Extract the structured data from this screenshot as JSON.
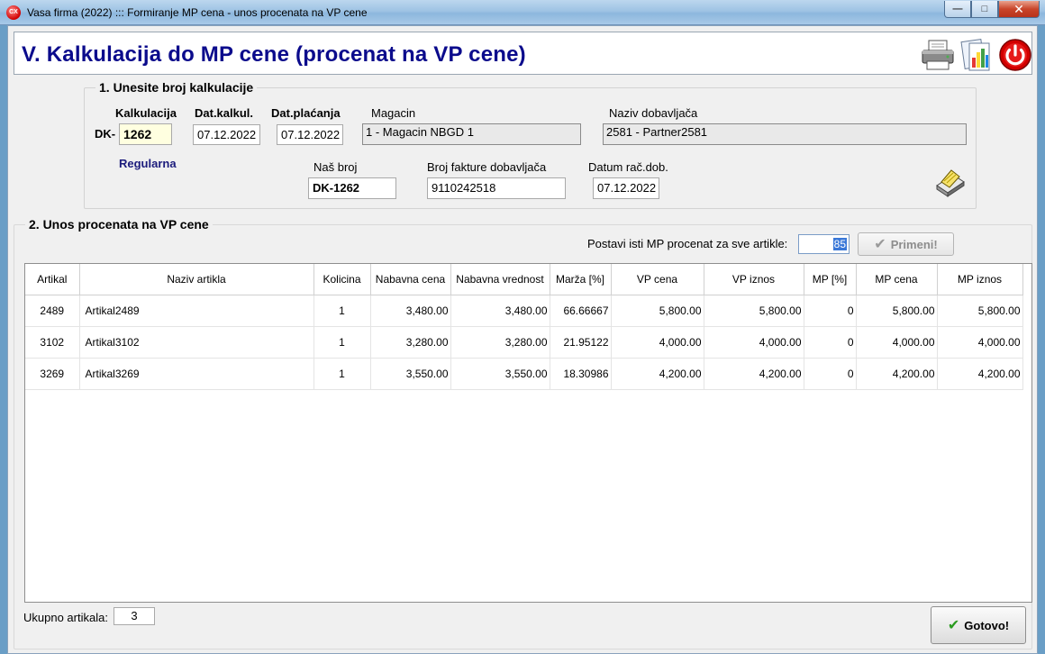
{
  "window": {
    "title": "Vasa firma (2022) ::: Formiranje MP cena - unos procenata na VP cene",
    "app_icon_text": "CX",
    "minimize_symbol": "—",
    "maximize_symbol": "□",
    "close_symbol": "✕"
  },
  "header": {
    "title": "V. Kalkulacija do MP cene (procenat na VP cene)"
  },
  "section1": {
    "title": "1. Unesite broj kalkulacije",
    "kalkulacija_label": "Kalkulacija",
    "prefix": "DK-",
    "kalkulacija_value": "1262",
    "type": "Regularna",
    "dat_kalkul_label": "Dat.kalkul.",
    "dat_kalkul_value": "07.12.2022",
    "dat_placanja_label": "Dat.plaćanja",
    "dat_placanja_value": "07.12.2022",
    "magacin_label": "Magacin",
    "magacin_value": "1 - Magacin NBGD 1",
    "dobavljac_label": "Naziv dobavljača",
    "dobavljac_value": "2581 - Partner2581",
    "nas_broj_label": "Naš broj",
    "nas_broj_value": "DK-1262",
    "broj_fakture_label": "Broj fakture dobavljača",
    "broj_fakture_value": "9110242518",
    "datum_rac_label": "Datum rač.dob.",
    "datum_rac_value": "07.12.2022"
  },
  "section2": {
    "title": "2. Unos procenata na VP cene",
    "set_all_label": "Postavi isti MP procenat za sve artikle:",
    "set_all_value": "85",
    "apply_label": "Primeni!"
  },
  "table": {
    "columns": [
      "Artikal",
      "Naziv artikla",
      "Kolicina",
      "Nabavna cena",
      "Nabavna vrednost",
      "Marža [%]",
      "VP cena",
      "VP iznos",
      "MP [%]",
      "MP cena",
      "MP iznos"
    ],
    "rows": [
      [
        "2489",
        "Artikal2489",
        "1",
        "3,480.00",
        "3,480.00",
        "66.66667",
        "5,800.00",
        "5,800.00",
        "0",
        "5,800.00",
        "5,800.00"
      ],
      [
        "3102",
        "Artikal3102",
        "1",
        "3,280.00",
        "3,280.00",
        "21.95122",
        "4,000.00",
        "4,000.00",
        "0",
        "4,000.00",
        "4,000.00"
      ],
      [
        "3269",
        "Artikal3269",
        "1",
        "3,550.00",
        "3,550.00",
        "18.30986",
        "4,200.00",
        "4,200.00",
        "0",
        "4,200.00",
        "4,200.00"
      ]
    ]
  },
  "footer": {
    "ukupno_label": "Ukupno artikala:",
    "ukupno_value": "3",
    "done_label": "Gotovo!"
  },
  "icons": {
    "printer": "printer-icon",
    "report": "chart-report-icon",
    "power": "power-icon",
    "scanner": "scanner-icon",
    "check": "✔"
  },
  "colors": {
    "title_blue": "#0b0b8c",
    "type_blue": "#1c1c7c",
    "check_green": "#2a9b1f",
    "power_red": "#d20000"
  }
}
